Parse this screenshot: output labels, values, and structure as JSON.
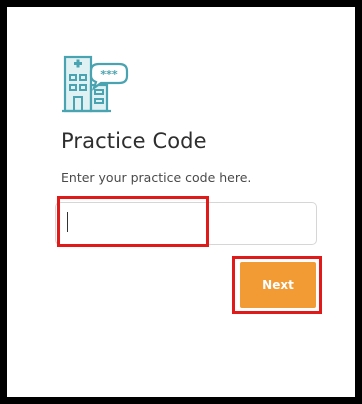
{
  "logo": {
    "icon": "hospital-building-chat-icon",
    "color": "#4aa3b0"
  },
  "form": {
    "title": "Practice Code",
    "instructions": "Enter your practice code here.",
    "code_input": {
      "value": "",
      "placeholder": ""
    },
    "next_label": "Next"
  },
  "colors": {
    "accent": "#f29a34",
    "highlight": "#e01919",
    "border": "#000000"
  },
  "annotations": [
    {
      "target": "practice-code-input",
      "type": "highlight-box"
    },
    {
      "target": "next-button",
      "type": "highlight-box"
    }
  ]
}
